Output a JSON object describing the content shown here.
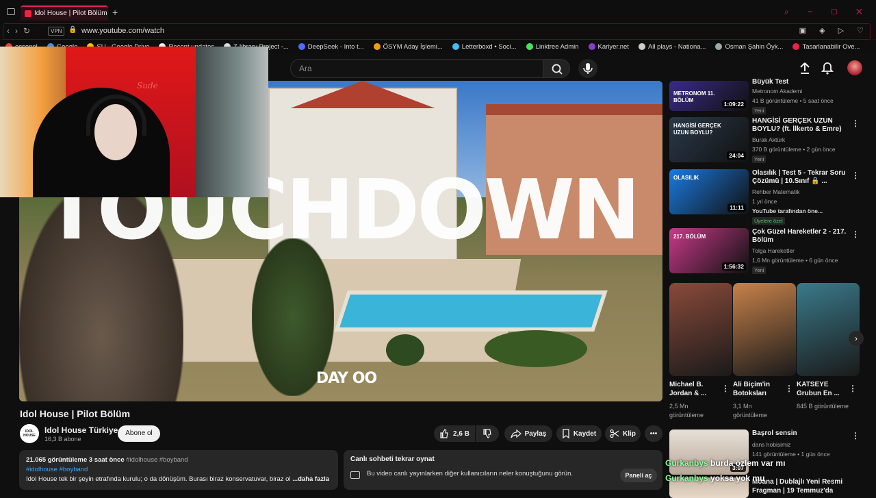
{
  "browser": {
    "tab_title": "Idol House | Pilot Bölüm - Y",
    "new_tab": "+",
    "url": "www.youtube.com/watch",
    "vpn_label": "VPN",
    "bookmarks": [
      {
        "label": "ecsenel",
        "color": "#d44"
      },
      {
        "label": "Google",
        "color": "#4a90e2"
      },
      {
        "label": "SU - Google Drive",
        "color": "#f4c20d"
      },
      {
        "label": "Recent updates",
        "color": "#eee"
      },
      {
        "label": "Z-library Project -...",
        "color": "#ddd"
      },
      {
        "label": "DeepSeek - Into t...",
        "color": "#4d6bfe"
      },
      {
        "label": "ÖSYM Aday İşlemi...",
        "color": "#f29b14"
      },
      {
        "label": "Letterboxd • Soci...",
        "color": "#40bcf4"
      },
      {
        "label": "Linktree Admin",
        "color": "#43e660"
      },
      {
        "label": "Kariyer.net",
        "color": "#8a3cc8"
      },
      {
        "label": "All plays - Nationa...",
        "color": "#ccc"
      },
      {
        "label": "Osman Şahin Öyk...",
        "color": "#9aa"
      },
      {
        "label": "Tasarlanabilir Ove...",
        "color": "#e24"
      }
    ]
  },
  "header": {
    "search_placeholder": "Ara"
  },
  "video": {
    "overlay_title": "TOUCHDOWN",
    "overlay_day": "DAY OO",
    "webcam_sign": "Sude",
    "title": "Idol House | Pilot Bölüm",
    "channel_avatar_text": "IDOL HOUSE",
    "channel_name": "Idol House Türkiye",
    "subscribers": "16,3 B abone",
    "subscribe_label": "Abone ol",
    "likes": "2,6 B",
    "share_label": "Paylaş",
    "save_label": "Kaydet",
    "clip_label": "Klip",
    "more_label": "•••"
  },
  "description": {
    "meta": "21.065 görüntüleme  3 saat önce",
    "meta_tags": "#idolhouse #boyband",
    "hashtags": "#idolhouse #boyband",
    "text": "Idol House tek bir şeyin etrafında kurulu; o da dönüşüm. Burası biraz konservatuvar, biraz ol",
    "more": "...daha fazla"
  },
  "live_chat": {
    "title": "Canlı sohbeti tekrar oynat",
    "body": "Bu video canlı yayınlarken diğer kullanıcıların neler konuştuğunu görün.",
    "button": "Paneli aç"
  },
  "recommendations": [
    {
      "title": "Büyük Test",
      "channel": "Metronom Akademi",
      "meta": "41 B görüntüleme • 5 saat önce",
      "badge": "Yeni",
      "duration": "1:09:22",
      "thumb_label": "METRONOM 11. BÖLÜM",
      "thumb_color": "#3a2a8a"
    },
    {
      "title": "HANGİSİ GERÇEK UZUN BOYLU? (ft. İlkerto & Emre)",
      "channel": "Burak Aktürk",
      "meta": "370 B görüntüleme • 2 gün önce",
      "badge": "Yeni",
      "duration": "24:04",
      "thumb_label": "HANGİSİ GERÇEK UZUN BOYLU?",
      "thumb_color": "#2a3a4a"
    },
    {
      "title": "Olasılık | Test 5 - Tekrar Soru Çözümü | 10.Sınıf 🔒 ...",
      "channel": "Rehber Matematik",
      "meta": "1 yıl önce",
      "badge": "Üyelere özel",
      "extra": "YouTube tarafından öne...",
      "duration": "11:11",
      "thumb_label": "OLASILIK",
      "thumb_color": "#1a7ae0"
    },
    {
      "title": "Çok Güzel Hareketler 2 - 217. Bölüm",
      "channel": "Tolga Hareketler",
      "meta": "1,6 Mn görüntüleme • 6 gün önce",
      "badge": "Yeni",
      "duration": "1:56:32",
      "thumb_label": "217. BÖLÜM",
      "thumb_color": "#c83a8a"
    }
  ],
  "shorts": [
    {
      "title": "Michael B. Jordan & ...",
      "views": "2,5 Mn görüntüleme",
      "color": "#8a4a3a"
    },
    {
      "title": "Ali Biçim'in Botoksları",
      "views": "3,1 Mn görüntüleme",
      "color": "#c8824a"
    },
    {
      "title": "KATSEYE Grubun En ...",
      "views": "845 B görüntüleme",
      "color": "#3a7a8a"
    }
  ],
  "last_rec": {
    "title": "Başrol sensin",
    "channel": "dans hobisimiz",
    "meta": "141 görüntüleme • 1 gün önce",
    "duration": "3:07",
    "title2": "Moana | Dublajlı Yeni Resmi",
    "sub2": "Fragman | 19 Temmuz'da"
  },
  "chat_overlay": [
    {
      "user": "Gurkanbys",
      "msg": "burda özlem var mı"
    },
    {
      "user": "Gurkanbys",
      "msg": "yoksa yok mu"
    }
  ],
  "colors": {
    "accent": "#e0245e",
    "link": "#3ea6ff"
  }
}
